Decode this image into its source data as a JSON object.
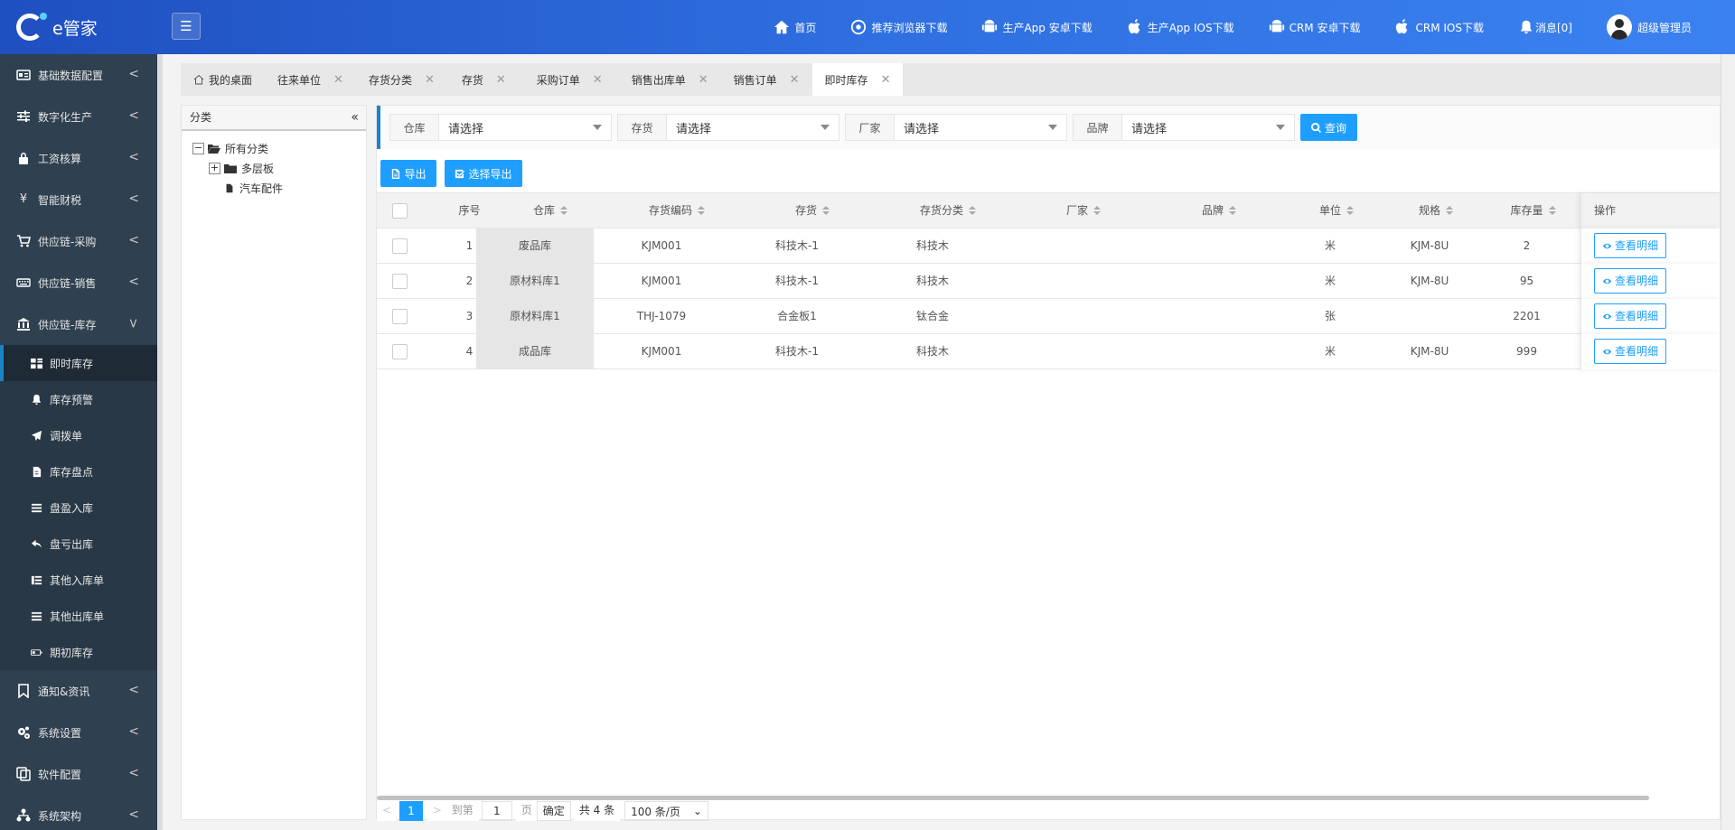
{
  "app": {
    "logo_text": "e管家"
  },
  "header": {
    "items": [
      {
        "icon": "home-icon",
        "label": "首页"
      },
      {
        "icon": "chrome-icon",
        "label": "推荐浏览器下载"
      },
      {
        "icon": "android-icon",
        "label": "生产App 安卓下载"
      },
      {
        "icon": "apple-icon",
        "label": "生产App IOS下载"
      },
      {
        "icon": "android-icon",
        "label": "CRM 安卓下载"
      },
      {
        "icon": "apple-icon",
        "label": "CRM IOS下载"
      },
      {
        "icon": "bell-icon",
        "label": "消息[0]"
      }
    ],
    "user": "超级管理员"
  },
  "sidebar": {
    "groups_top": [
      {
        "label": "基础数据配置",
        "icon": "id-card-icon"
      },
      {
        "label": "数字化生产",
        "icon": "sliders-icon"
      },
      {
        "label": "工资核算",
        "icon": "lock-icon"
      },
      {
        "label": "智能财税",
        "icon": "yen-icon"
      },
      {
        "label": "供应链-采购",
        "icon": "cart-icon"
      },
      {
        "label": "供应链-销售",
        "icon": "keyboard-icon"
      },
      {
        "label": "供应链-库存",
        "icon": "bank-icon"
      }
    ],
    "sub_items": [
      {
        "label": "即时库存",
        "icon": "grid-icon",
        "active": true
      },
      {
        "label": "库存预警",
        "icon": "bell-icon"
      },
      {
        "label": "调拨单",
        "icon": "send-icon"
      },
      {
        "label": "库存盘点",
        "icon": "file-icon"
      },
      {
        "label": "盘盈入库",
        "icon": "list-icon"
      },
      {
        "label": "盘亏出库",
        "icon": "reply-icon"
      },
      {
        "label": "其他入库单",
        "icon": "table-icon"
      },
      {
        "label": "其他出库单",
        "icon": "list-icon"
      },
      {
        "label": "期初库存",
        "icon": "battery-icon"
      }
    ],
    "groups_bottom": [
      {
        "label": "通知&资讯",
        "icon": "bookmark-icon"
      },
      {
        "label": "系统设置",
        "icon": "gears-icon"
      },
      {
        "label": "软件配置",
        "icon": "copy-icon"
      },
      {
        "label": "系统架构",
        "icon": "sitemap-icon"
      }
    ]
  },
  "tabs": [
    {
      "label": "我的桌面",
      "home": true
    },
    {
      "label": "往来单位"
    },
    {
      "label": "存货分类"
    },
    {
      "label": "存货"
    },
    {
      "label": "采购订单"
    },
    {
      "label": "销售出库单"
    },
    {
      "label": "销售订单"
    },
    {
      "label": "即时库存",
      "active": true
    }
  ],
  "category": {
    "title": "分类",
    "root": "所有分类",
    "children": [
      "多层板",
      "汽车配件"
    ]
  },
  "filters": [
    {
      "label": "仓库",
      "placeholder": "请选择"
    },
    {
      "label": "存货",
      "placeholder": "请选择"
    },
    {
      "label": "厂家",
      "placeholder": "请选择"
    },
    {
      "label": "品牌",
      "placeholder": "请选择"
    }
  ],
  "buttons": {
    "query": "查询",
    "export": "导出",
    "export_selected": "选择导出"
  },
  "table": {
    "columns": [
      "序号",
      "仓库",
      "存货编码",
      "存货",
      "存货分类",
      "厂家",
      "品牌",
      "单位",
      "规格",
      "库存量",
      "操作"
    ],
    "rows": [
      {
        "no": "1",
        "warehouse": "废品库",
        "code": "KJM001",
        "item": "科技木-1",
        "category": "科技木",
        "vendor": "",
        "brand": "",
        "unit": "米",
        "spec": "KJM-8U",
        "qty": "2"
      },
      {
        "no": "2",
        "warehouse": "原材料库1",
        "code": "KJM001",
        "item": "科技木-1",
        "category": "科技木",
        "vendor": "",
        "brand": "",
        "unit": "米",
        "spec": "KJM-8U",
        "qty": "95"
      },
      {
        "no": "3",
        "warehouse": "原材料库1",
        "code": "THJ-1079",
        "item": "合金板1",
        "category": "钛合金",
        "vendor": "",
        "brand": "",
        "unit": "张",
        "spec": "",
        "qty": "2201"
      },
      {
        "no": "4",
        "warehouse": "成品库",
        "code": "KJM001",
        "item": "科技木-1",
        "category": "科技木",
        "vendor": "",
        "brand": "",
        "unit": "米",
        "spec": "KJM-8U",
        "qty": "999"
      }
    ],
    "row_action": "查看明细"
  },
  "pager": {
    "prev": "<",
    "current": "1",
    "next": ">",
    "goto_label": "到第",
    "goto_value": "1",
    "page_label": "页",
    "confirm": "确定",
    "total": "共 4 条",
    "page_size": "100 条/页"
  }
}
